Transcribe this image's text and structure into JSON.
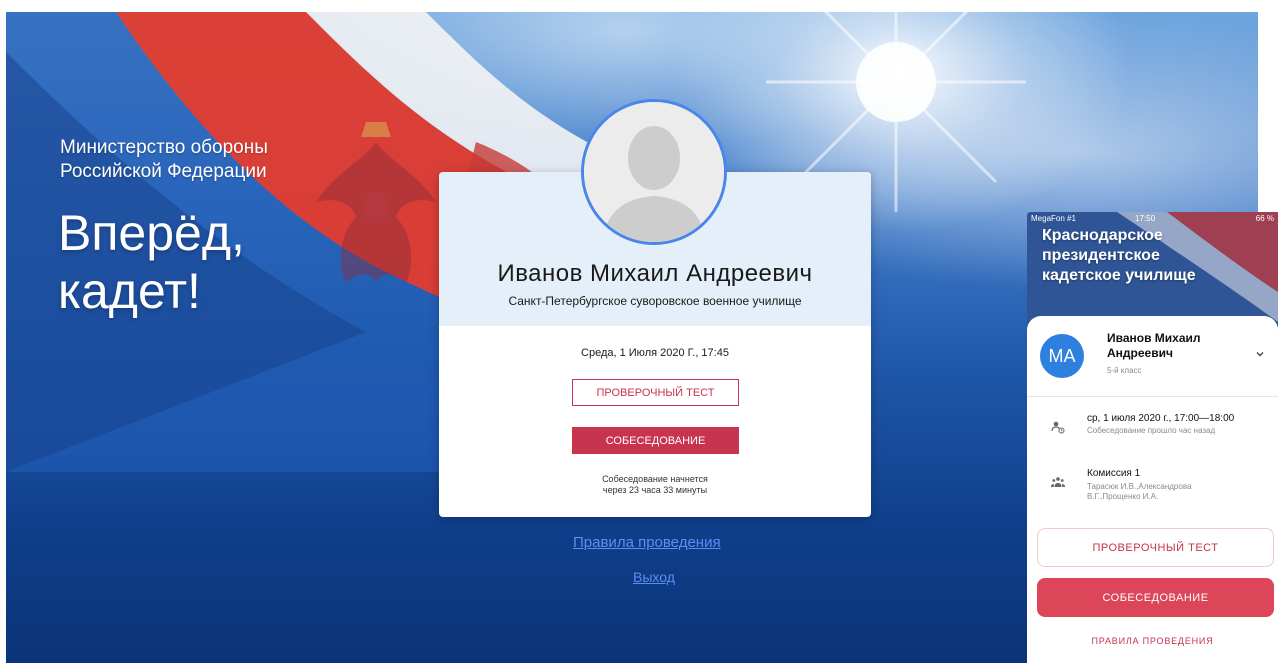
{
  "desktop": {
    "ministry_line1": "Министерство обороны",
    "ministry_line2": "Российской Федерации",
    "slogan_line1": "Вперёд,",
    "slogan_line2": "кадет!",
    "card": {
      "name": "Иванов  Михаил  Андреевич",
      "school": "Санкт-Петербургское суворовское военное училище",
      "datetime": "Среда, 1 Июля 2020 Г., 17:45",
      "test_button": "ПРОВЕРОЧНЫЙ ТЕСТ",
      "interview_button": "СОБЕСЕДОВАНИЕ",
      "note_line1": "Собеседование начнется",
      "note_line2": "через 23 часа 33 минуты"
    },
    "links": {
      "rules": "Правила проведения",
      "exit": "Выход"
    }
  },
  "phone": {
    "status": {
      "carrier": "MegaFon #1",
      "time": "17:50",
      "battery": "66 %"
    },
    "title_line1": "Краснодарское",
    "title_line2": "президентское",
    "title_line3": "кадетское училище",
    "profile": {
      "initials": "МА",
      "name_line1": "Иванов Михаил",
      "name_line2": "Андреевич",
      "grade": "5-й класс"
    },
    "schedule": {
      "date": "ср, 1 июля 2020 г., 17:00—18:00",
      "status": "Собеседование прошло час назад"
    },
    "commission": {
      "name": "Комиссия 1",
      "members_line1": "Тарасюк И.В.,Александрова",
      "members_line2": "В.Г.,Прощенко И.А."
    },
    "test_button": "ПРОВЕРОЧНЫЙ ТЕСТ",
    "interview_button": "СОБЕСЕДОВАНИЕ",
    "rules_link": "ПРАВИЛА ПРОВЕДЕНИЯ"
  },
  "colors": {
    "accent_red": "#c8334d",
    "link_blue": "#5b8df5",
    "avatar_blue": "#2d7fe0",
    "card_header": "#e4eff9"
  }
}
